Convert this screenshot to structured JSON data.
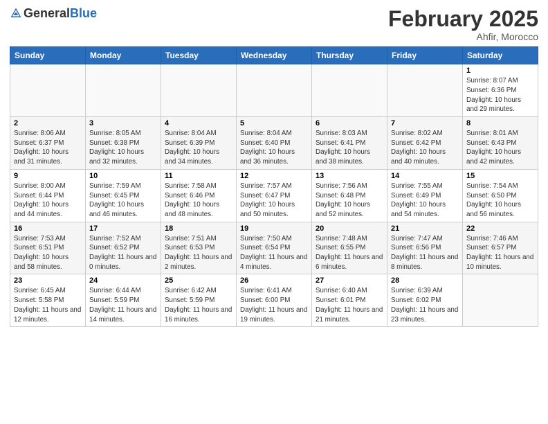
{
  "logo": {
    "general": "General",
    "blue": "Blue"
  },
  "header": {
    "title": "February 2025",
    "subtitle": "Ahfir, Morocco"
  },
  "days_of_week": [
    "Sunday",
    "Monday",
    "Tuesday",
    "Wednesday",
    "Thursday",
    "Friday",
    "Saturday"
  ],
  "weeks": [
    [
      {
        "day": "",
        "info": ""
      },
      {
        "day": "",
        "info": ""
      },
      {
        "day": "",
        "info": ""
      },
      {
        "day": "",
        "info": ""
      },
      {
        "day": "",
        "info": ""
      },
      {
        "day": "",
        "info": ""
      },
      {
        "day": "1",
        "info": "Sunrise: 8:07 AM\nSunset: 6:36 PM\nDaylight: 10 hours and 29 minutes."
      }
    ],
    [
      {
        "day": "2",
        "info": "Sunrise: 8:06 AM\nSunset: 6:37 PM\nDaylight: 10 hours and 31 minutes."
      },
      {
        "day": "3",
        "info": "Sunrise: 8:05 AM\nSunset: 6:38 PM\nDaylight: 10 hours and 32 minutes."
      },
      {
        "day": "4",
        "info": "Sunrise: 8:04 AM\nSunset: 6:39 PM\nDaylight: 10 hours and 34 minutes."
      },
      {
        "day": "5",
        "info": "Sunrise: 8:04 AM\nSunset: 6:40 PM\nDaylight: 10 hours and 36 minutes."
      },
      {
        "day": "6",
        "info": "Sunrise: 8:03 AM\nSunset: 6:41 PM\nDaylight: 10 hours and 38 minutes."
      },
      {
        "day": "7",
        "info": "Sunrise: 8:02 AM\nSunset: 6:42 PM\nDaylight: 10 hours and 40 minutes."
      },
      {
        "day": "8",
        "info": "Sunrise: 8:01 AM\nSunset: 6:43 PM\nDaylight: 10 hours and 42 minutes."
      }
    ],
    [
      {
        "day": "9",
        "info": "Sunrise: 8:00 AM\nSunset: 6:44 PM\nDaylight: 10 hours and 44 minutes."
      },
      {
        "day": "10",
        "info": "Sunrise: 7:59 AM\nSunset: 6:45 PM\nDaylight: 10 hours and 46 minutes."
      },
      {
        "day": "11",
        "info": "Sunrise: 7:58 AM\nSunset: 6:46 PM\nDaylight: 10 hours and 48 minutes."
      },
      {
        "day": "12",
        "info": "Sunrise: 7:57 AM\nSunset: 6:47 PM\nDaylight: 10 hours and 50 minutes."
      },
      {
        "day": "13",
        "info": "Sunrise: 7:56 AM\nSunset: 6:48 PM\nDaylight: 10 hours and 52 minutes."
      },
      {
        "day": "14",
        "info": "Sunrise: 7:55 AM\nSunset: 6:49 PM\nDaylight: 10 hours and 54 minutes."
      },
      {
        "day": "15",
        "info": "Sunrise: 7:54 AM\nSunset: 6:50 PM\nDaylight: 10 hours and 56 minutes."
      }
    ],
    [
      {
        "day": "16",
        "info": "Sunrise: 7:53 AM\nSunset: 6:51 PM\nDaylight: 10 hours and 58 minutes."
      },
      {
        "day": "17",
        "info": "Sunrise: 7:52 AM\nSunset: 6:52 PM\nDaylight: 11 hours and 0 minutes."
      },
      {
        "day": "18",
        "info": "Sunrise: 7:51 AM\nSunset: 6:53 PM\nDaylight: 11 hours and 2 minutes."
      },
      {
        "day": "19",
        "info": "Sunrise: 7:50 AM\nSunset: 6:54 PM\nDaylight: 11 hours and 4 minutes."
      },
      {
        "day": "20",
        "info": "Sunrise: 7:48 AM\nSunset: 6:55 PM\nDaylight: 11 hours and 6 minutes."
      },
      {
        "day": "21",
        "info": "Sunrise: 7:47 AM\nSunset: 6:56 PM\nDaylight: 11 hours and 8 minutes."
      },
      {
        "day": "22",
        "info": "Sunrise: 7:46 AM\nSunset: 6:57 PM\nDaylight: 11 hours and 10 minutes."
      }
    ],
    [
      {
        "day": "23",
        "info": "Sunrise: 6:45 AM\nSunset: 5:58 PM\nDaylight: 11 hours and 12 minutes."
      },
      {
        "day": "24",
        "info": "Sunrise: 6:44 AM\nSunset: 5:59 PM\nDaylight: 11 hours and 14 minutes."
      },
      {
        "day": "25",
        "info": "Sunrise: 6:42 AM\nSunset: 5:59 PM\nDaylight: 11 hours and 16 minutes."
      },
      {
        "day": "26",
        "info": "Sunrise: 6:41 AM\nSunset: 6:00 PM\nDaylight: 11 hours and 19 minutes."
      },
      {
        "day": "27",
        "info": "Sunrise: 6:40 AM\nSunset: 6:01 PM\nDaylight: 11 hours and 21 minutes."
      },
      {
        "day": "28",
        "info": "Sunrise: 6:39 AM\nSunset: 6:02 PM\nDaylight: 11 hours and 23 minutes."
      },
      {
        "day": "",
        "info": ""
      }
    ]
  ]
}
